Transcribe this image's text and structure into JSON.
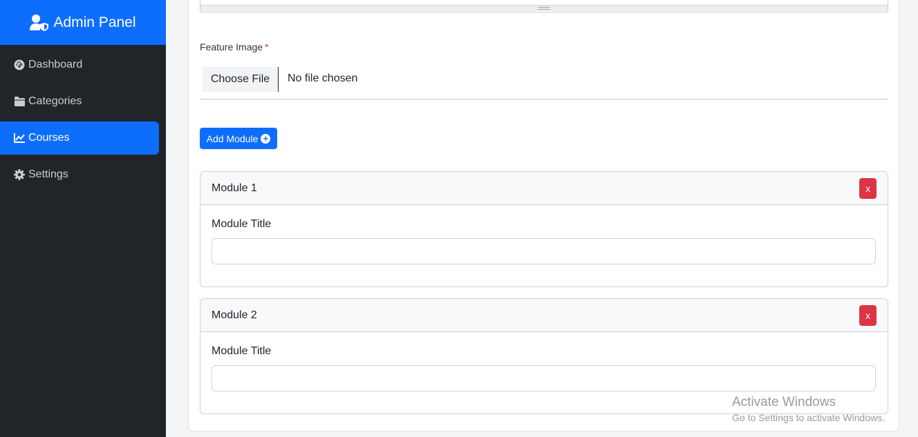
{
  "sidebar": {
    "brand": "Admin Panel",
    "items": [
      {
        "label": "Dashboard",
        "icon": "tachometer-icon",
        "active": false
      },
      {
        "label": "Categories",
        "icon": "folder-icon",
        "active": false
      },
      {
        "label": "Courses",
        "icon": "chart-line-icon",
        "active": true
      },
      {
        "label": "Settings",
        "icon": "gear-icon",
        "active": false
      }
    ]
  },
  "form": {
    "feature_image_label": "Feature Image",
    "required_mark": "*",
    "file_button": "Choose File",
    "file_status": "No file chosen",
    "add_module_label": "Add Module"
  },
  "modules": [
    {
      "header": "Module 1",
      "remove_label": "x",
      "field_label": "Module Title",
      "value": ""
    },
    {
      "header": "Module 2",
      "remove_label": "x",
      "field_label": "Module Title",
      "value": ""
    }
  ],
  "watermark": {
    "line1": "Activate Windows",
    "line2": "Go to Settings to activate Windows."
  },
  "colors": {
    "primary": "#0d6efd",
    "danger": "#dc3545",
    "sidebar_bg": "#212529"
  }
}
